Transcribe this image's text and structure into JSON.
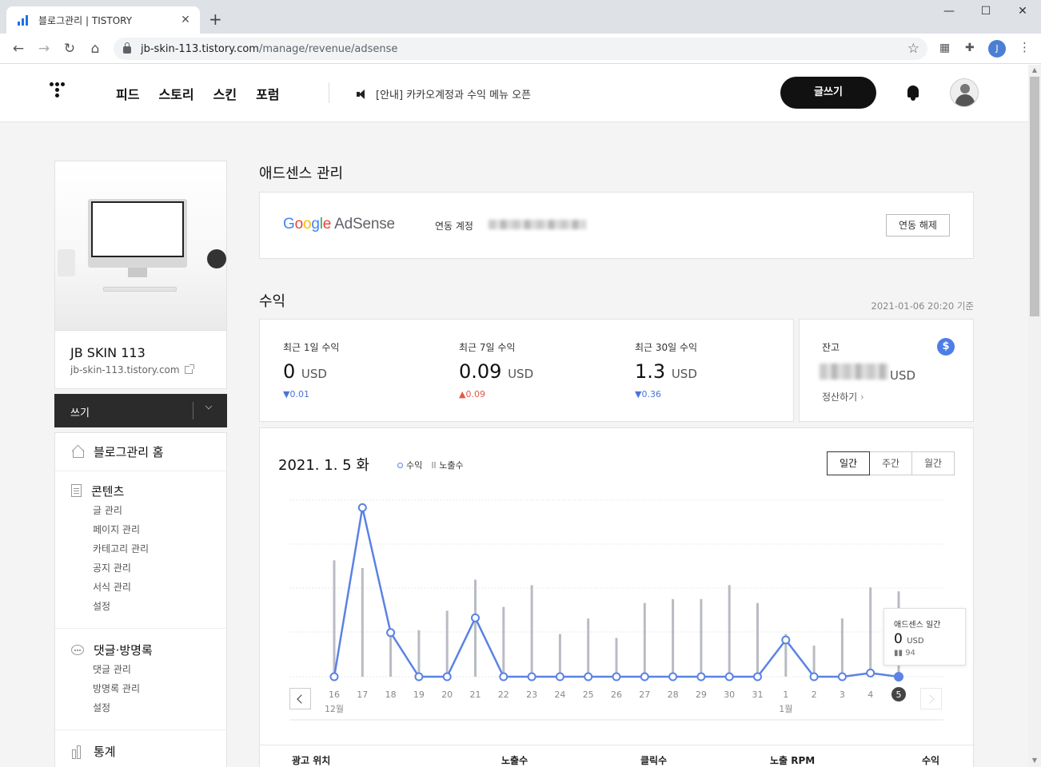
{
  "browser": {
    "tab_title": "블로그관리 | TISTORY",
    "tab_close": "✕",
    "new_tab": "+",
    "window_min": "—",
    "window_max": "☐",
    "window_close": "✕",
    "url_host": "jb-skin-113.tistory.com",
    "url_path": "/manage/revenue/adsense",
    "profile_initial": "J"
  },
  "header": {
    "nav": [
      "피드",
      "스토리",
      "스킨",
      "포럼"
    ],
    "notice": "[안내] 카카오계정과 수익 메뉴 오픈",
    "write_button": "글쓰기"
  },
  "sidebar": {
    "blog_name": "JB SKIN 113",
    "blog_url": "jb-skin-113.tistory.com",
    "write_label": "쓰기",
    "menu": [
      {
        "label": "블로그관리 홈",
        "icon": "home-icon",
        "items": []
      },
      {
        "label": "콘텐츠",
        "icon": "document-icon",
        "items": [
          "글 관리",
          "페이지 관리",
          "카테고리 관리",
          "공지 관리",
          "서식 관리",
          "설정"
        ]
      },
      {
        "label": "댓글·방명록",
        "icon": "chat-icon",
        "items": [
          "댓글 관리",
          "방명록 관리",
          "설정"
        ]
      },
      {
        "label": "통계",
        "icon": "stats-icon",
        "items": []
      }
    ]
  },
  "adsense": {
    "title": "애드센스 관리",
    "logo": {
      "google": [
        "G",
        "o",
        "o",
        "g",
        "l",
        "e"
      ],
      "product": " AdSense"
    },
    "linked_label": "연동 계정",
    "unlink_button": "연동 해제"
  },
  "revenue": {
    "title": "수익",
    "as_of": "2021-01-06 20:20 기준",
    "stats": [
      {
        "label": "최근 1일 수익",
        "value": "0",
        "unit": "USD",
        "delta": "▼0.01",
        "dir": "down"
      },
      {
        "label": "최근 7일 수익",
        "value": "0.09",
        "unit": "USD",
        "delta": "▲0.09",
        "dir": "up"
      },
      {
        "label": "최근 30일 수익",
        "value": "1.3",
        "unit": "USD",
        "delta": "▼0.36",
        "dir": "down"
      }
    ],
    "balance_label": "잔고",
    "balance_unit": "USD",
    "balance_icon": "$",
    "settle_link": "정산하기",
    "settle_chevron": "›"
  },
  "chart_panel": {
    "date": "2021. 1. 5 화",
    "legend_revenue": "수익",
    "legend_impressions": "노출수",
    "periods": [
      "일간",
      "주간",
      "월간"
    ],
    "active_period": 0,
    "tooltip": {
      "title": "애드센스 일간",
      "value": "0",
      "unit": "USD",
      "impressions": "94"
    },
    "table_headers": [
      "광고 위치",
      "노출수",
      "클릭수",
      "노출 RPM",
      "수익"
    ]
  },
  "chart_data": {
    "type": "line",
    "x": [
      "16",
      "17",
      "18",
      "19",
      "20",
      "21",
      "22",
      "23",
      "24",
      "25",
      "26",
      "27",
      "28",
      "29",
      "30",
      "31",
      "1",
      "2",
      "3",
      "4",
      "5"
    ],
    "month_labels": [
      {
        "index": 0,
        "label": "12월"
      },
      {
        "index": 16,
        "label": "1월"
      }
    ],
    "series": [
      {
        "name": "수익",
        "type": "line",
        "values": [
          0.0,
          0.23,
          0.06,
          0.0,
          0.0,
          0.08,
          0.0,
          0.0,
          0.0,
          0.0,
          0.0,
          0.0,
          0.0,
          0.0,
          0.0,
          0.0,
          0.05,
          0.0,
          0.0,
          0.005,
          0.0
        ],
        "color": "#5b82e4"
      },
      {
        "name": "노출수",
        "type": "bar",
        "values": [
          150,
          140,
          60,
          60,
          85,
          125,
          90,
          118,
          55,
          75,
          50,
          95,
          100,
          100,
          118,
          95,
          55,
          40,
          75,
          115,
          110
        ],
        "color": "#b8bcc2"
      }
    ],
    "highlight_index": 20,
    "grid": true
  }
}
